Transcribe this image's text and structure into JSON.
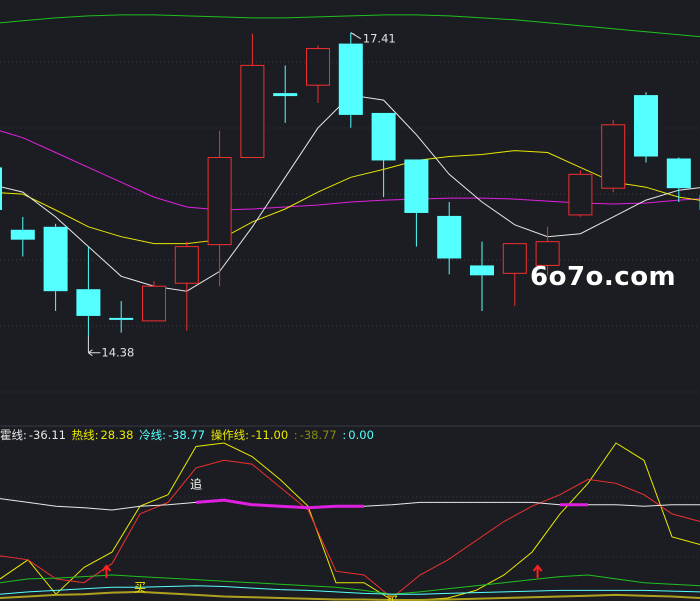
{
  "chart_data": [
    {
      "type": "candlestick",
      "panel": "main",
      "title": "",
      "ylim": [
        13.6,
        17.7
      ],
      "high_label": "17.41",
      "low_label": "14.38",
      "candles": [
        {
          "o": 16.05,
          "c": 15.62,
          "h": 16.2,
          "l": 15.5,
          "up": false
        },
        {
          "o": 15.42,
          "c": 15.32,
          "h": 15.55,
          "l": 15.15,
          "up": false
        },
        {
          "o": 15.45,
          "c": 14.8,
          "h": 15.48,
          "l": 14.6,
          "up": false
        },
        {
          "o": 14.82,
          "c": 14.55,
          "h": 15.25,
          "l": 14.35,
          "up": false
        },
        {
          "o": 14.53,
          "c": 14.51,
          "h": 14.7,
          "l": 14.38,
          "up": false
        },
        {
          "o": 14.5,
          "c": 14.85,
          "h": 14.9,
          "l": 14.5,
          "up": true
        },
        {
          "o": 14.88,
          "c": 15.25,
          "h": 15.3,
          "l": 14.4,
          "up": true
        },
        {
          "o": 15.27,
          "c": 16.15,
          "h": 16.42,
          "l": 14.85,
          "up": true
        },
        {
          "o": 16.15,
          "c": 17.08,
          "h": 17.4,
          "l": 16.15,
          "up": true
        },
        {
          "o": 16.8,
          "c": 16.77,
          "h": 17.08,
          "l": 16.5,
          "up": false
        },
        {
          "o": 16.88,
          "c": 17.25,
          "h": 17.28,
          "l": 16.7,
          "up": true
        },
        {
          "o": 17.3,
          "c": 16.58,
          "h": 17.41,
          "l": 16.45,
          "up": false
        },
        {
          "o": 16.6,
          "c": 16.12,
          "h": 16.6,
          "l": 15.75,
          "up": false
        },
        {
          "o": 16.13,
          "c": 15.59,
          "h": 16.13,
          "l": 15.25,
          "up": false
        },
        {
          "o": 15.56,
          "c": 15.13,
          "h": 15.7,
          "l": 14.97,
          "up": false
        },
        {
          "o": 15.06,
          "c": 14.96,
          "h": 15.3,
          "l": 14.6,
          "up": false
        },
        {
          "o": 14.98,
          "c": 15.28,
          "h": 15.28,
          "l": 14.65,
          "up": true
        },
        {
          "o": 15.06,
          "c": 15.3,
          "h": 15.45,
          "l": 14.96,
          "up": true
        },
        {
          "o": 15.57,
          "c": 15.98,
          "h": 16.02,
          "l": 15.55,
          "up": true
        },
        {
          "o": 15.84,
          "c": 16.48,
          "h": 16.53,
          "l": 15.8,
          "up": true
        },
        {
          "o": 16.78,
          "c": 16.16,
          "h": 16.81,
          "l": 16.1,
          "up": false
        },
        {
          "o": 16.14,
          "c": 15.84,
          "h": 16.15,
          "l": 15.7,
          "up": false
        },
        {
          "o": 15.77,
          "c": 15.62,
          "h": 15.77,
          "l": 15.55,
          "up": false
        }
      ],
      "ma_white": [
        15.88,
        15.8,
        15.55,
        15.25,
        14.95,
        14.85,
        14.8,
        15.0,
        15.45,
        15.95,
        16.45,
        16.78,
        16.73,
        16.38,
        15.98,
        15.7,
        15.47,
        15.35,
        15.38,
        15.55,
        15.72,
        15.82,
        15.86
      ],
      "ma_yellow": [
        15.8,
        15.78,
        15.62,
        15.45,
        15.35,
        15.28,
        15.28,
        15.32,
        15.5,
        15.63,
        15.8,
        15.95,
        16.03,
        16.12,
        16.16,
        16.18,
        16.22,
        16.2,
        16.05,
        15.9,
        15.85,
        15.75,
        15.7
      ],
      "ma_magenta": [
        16.45,
        16.35,
        16.2,
        16.05,
        15.9,
        15.75,
        15.65,
        15.62,
        15.63,
        15.65,
        15.67,
        15.7,
        15.72,
        15.73,
        15.74,
        15.74,
        15.73,
        15.71,
        15.69,
        15.68,
        15.69,
        15.72,
        15.74
      ],
      "ma_green": [
        17.5,
        17.53,
        17.56,
        17.58,
        17.59,
        17.59,
        17.58,
        17.57,
        17.56,
        17.56,
        17.57,
        17.58,
        17.59,
        17.59,
        17.58,
        17.56,
        17.54,
        17.51,
        17.48,
        17.45,
        17.42,
        17.39,
        17.36
      ],
      "colors": {
        "up": "#f03030",
        "down": "#54ffff",
        "white": "#e8e8e8",
        "yellow": "#e8e800",
        "magenta": "#e020e0",
        "green": "#20c020"
      }
    },
    {
      "type": "line",
      "panel": "indicator",
      "title": "",
      "ylim": [
        -100,
        100
      ],
      "legend": [
        {
          "label": "霍线:",
          "value": "-36.11",
          "color": "#e8e8e8"
        },
        {
          "label": "热线:",
          "value": "28.38",
          "color": "#e8e800"
        },
        {
          "label": "冷线:",
          "value": "-38.77",
          "color": "#54ffff"
        },
        {
          "label": "操作线:",
          "value": "-11.00",
          "color": "#e8e800"
        },
        {
          "label": ":",
          "value": "-38.77",
          "color": "#8a8a10"
        },
        {
          "label": ":",
          "value": "0.00",
          "color": "#54ffff"
        }
      ],
      "series": [
        {
          "color": "#e8e800",
          "values": [
            -75,
            -50,
            -95,
            -60,
            -40,
            20,
            35,
            98,
            110,
            85,
            55,
            20,
            -80,
            -80,
            -110,
            -120,
            -100,
            -90,
            -70,
            -40,
            10,
            50,
            110,
            80,
            -20,
            -30
          ]
        },
        {
          "color": "#f03030",
          "values": [
            -45,
            -50,
            -75,
            -80,
            -55,
            10,
            25,
            70,
            80,
            75,
            45,
            15,
            -65,
            -70,
            -100,
            -70,
            -50,
            -25,
            0,
            20,
            35,
            55,
            50,
            35,
            10,
            0
          ]
        },
        {
          "color": "#e8e8e8",
          "values": [
            30,
            25,
            20,
            18,
            15,
            20,
            22,
            25,
            28,
            22,
            20,
            18,
            20,
            20,
            22,
            25,
            25,
            25,
            25,
            25,
            22,
            22,
            22,
            20,
            22,
            22
          ]
        },
        {
          "color": "#20c020",
          "values": [
            -80,
            -75,
            -74,
            -72,
            -70,
            -72,
            -74,
            -76,
            -78,
            -80,
            -82,
            -84,
            -86,
            -90,
            -95,
            -92,
            -88,
            -84,
            -80,
            -76,
            -72,
            -70,
            -75,
            -80,
            -82,
            -84
          ]
        },
        {
          "color": "#54ffff",
          "values": [
            -95,
            -92,
            -90,
            -88,
            -86,
            -86,
            -85,
            -84,
            -85,
            -87,
            -89,
            -90,
            -92,
            -94,
            -95,
            -95,
            -94,
            -93,
            -92,
            -91,
            -90,
            -90,
            -90,
            -90,
            -91,
            -92
          ]
        },
        {
          "color": "#b0a020",
          "values": [
            -100,
            -98,
            -96,
            -95,
            -93,
            -92,
            -94,
            -96,
            -98,
            -99,
            -100,
            -101,
            -102,
            -102,
            -103,
            -103,
            -102,
            -101,
            -100,
            -99,
            -98,
            -97,
            -96,
            -97,
            -98,
            -100
          ]
        }
      ],
      "magenta_segments": [
        [
          7,
          13
        ],
        [
          20,
          21
        ]
      ],
      "annotations": [
        {
          "text": "追",
          "color": "#ffffff",
          "x": 7,
          "y": 50
        },
        {
          "text": "买",
          "color": "#e8e800",
          "x": 5,
          "y": -85
        },
        {
          "text": "买",
          "color": "#e8e800",
          "x": 14,
          "y": -110
        }
      ],
      "arrows": [
        3.8,
        19.2
      ]
    }
  ],
  "watermark": "6o7o.com"
}
